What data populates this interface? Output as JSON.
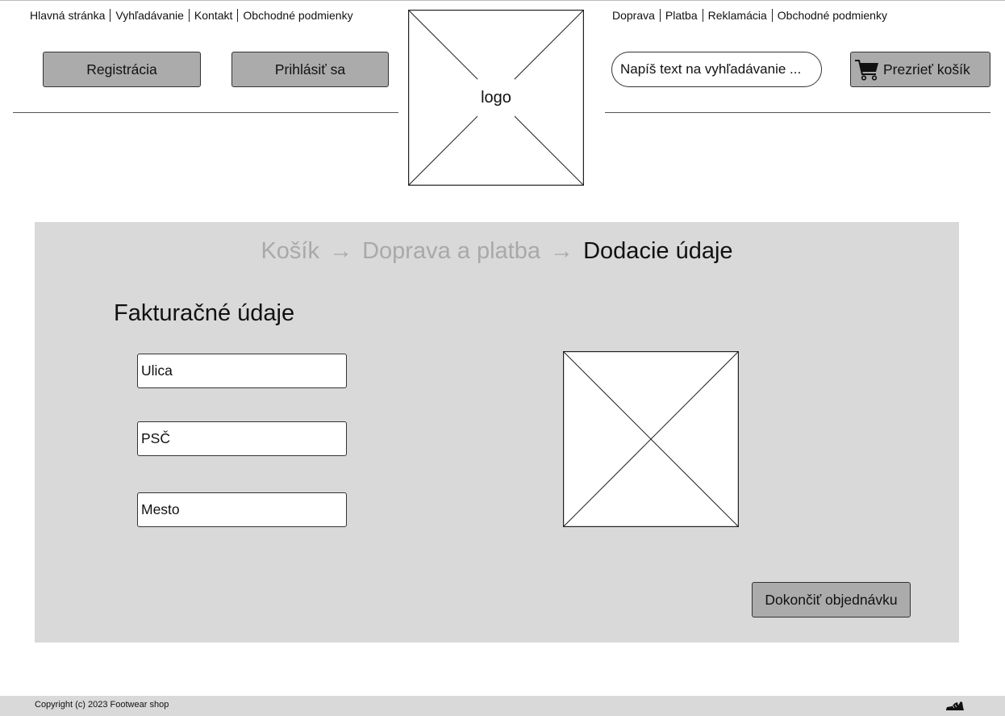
{
  "header": {
    "nav_left": [
      "Hlavná stránka",
      "Vyhľadávanie",
      "Kontakt",
      "Obchodné podmienky"
    ],
    "nav_right": [
      "Doprava",
      "Platba",
      "Reklamácia",
      "Obchodné podmienky"
    ],
    "register_label": "Registrácia",
    "login_label": "Prihlásiť sa",
    "logo_text": "logo",
    "search_placeholder": "Napíš text na vyhľadávanie ...",
    "cart_label": "Prezrieť košík"
  },
  "checkout": {
    "steps": [
      "Košík",
      "Doprava a platba",
      "Dodacie údaje"
    ],
    "arrow": "→",
    "section_title": "Fakturačné údaje",
    "fields": {
      "street_placeholder": "Ulica",
      "zip_placeholder": "PSČ",
      "city_placeholder": "Mesto"
    },
    "finish_label": "Dokončiť objednávku"
  },
  "footer": {
    "copyright": "Copyright (c) 2023 Footwear shop"
  },
  "icons": {
    "cart": "shopping-cart-icon",
    "footer_logo": "shoe-icon",
    "image_placeholder": "image-placeholder-icon"
  }
}
